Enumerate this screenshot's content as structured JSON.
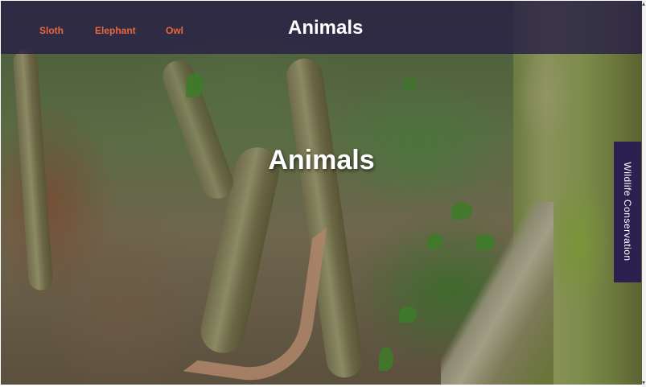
{
  "nav": {
    "links": [
      "Sloth",
      "Elephant",
      "Owl"
    ],
    "brand": "Animals"
  },
  "hero": {
    "title": "Animals",
    "background": "forest-tree-trunk-photo"
  },
  "side_tab": {
    "label": "Wildlife Conservation"
  },
  "colors": {
    "navbar": "#282046",
    "nav_link": "#e8683e",
    "side_tab": "#2b2050",
    "text": "#ffffff"
  }
}
